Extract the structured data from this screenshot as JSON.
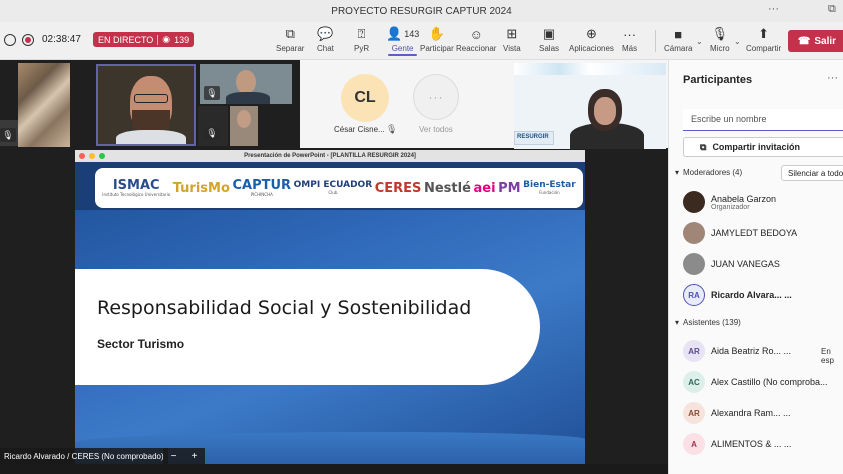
{
  "window": {
    "title": "PROYECTO RESURGIR CAPTUR 2024",
    "more": "···",
    "restore": "⧉"
  },
  "toolbar": {
    "timer": "02:38:47",
    "live_label": "EN DIRECTO",
    "viewers": "139",
    "people_count": "143",
    "buttons": {
      "separar": "Separar",
      "chat": "Chat",
      "pyr": "PyR",
      "gente": "Gente",
      "participar": "Participar",
      "reaccionar": "Reaccionar",
      "vista": "Vista",
      "salas": "Salas",
      "aplicaciones": "Aplicaciones",
      "mas": "Más",
      "camara": "Cámara",
      "micro": "Micro",
      "compartir": "Compartir"
    },
    "leave": "Salir"
  },
  "stage": {
    "cl_initials": "CL",
    "cl_name": "César Cisne...",
    "more_dots": "···",
    "ver_todos": "Ver todos",
    "woman_banner": "RESURGIR",
    "name_tag": "Ricardo Alvarado / CERES (No comprobado)",
    "zoom_minus": "−",
    "zoom_plus": "+"
  },
  "presentation": {
    "window_title": "Presentación de PowerPoint - [PLANTILLA RESURGIR 2024]",
    "logos": [
      {
        "text": "ISMAC",
        "sub": "Instituto Tecnológico Universitario",
        "color": "#2b4c8c"
      },
      {
        "text": "TurisMo",
        "sub": "",
        "color": "#d2a429"
      },
      {
        "text": "CAPTUR",
        "sub": "PICHINCHA",
        "color": "#1a5fa8"
      },
      {
        "text": "OMPI ECUADOR",
        "sub": "Club",
        "color": "#1f3f7a"
      },
      {
        "text": "CERES",
        "sub": "",
        "color": "#c0392b"
      },
      {
        "text": "Nestlé",
        "sub": "",
        "color": "#555555"
      },
      {
        "text": "aei",
        "sub": "",
        "color": "#e4007f"
      },
      {
        "text": "PM",
        "sub": "",
        "color": "#7b3fa0"
      },
      {
        "text": "Bien-Estar",
        "sub": "Fundación",
        "color": "#1f5ea8"
      }
    ],
    "title": "Responsabilidad Social y Sostenibilidad",
    "subtitle": "Sector Turismo"
  },
  "panel": {
    "title": "Participantes",
    "more": "···",
    "search_placeholder": "Escribe un nombre",
    "invite": "Compartir invitación",
    "moderators_header": "Moderadores (4)",
    "mute_all": "Silenciar a todos",
    "moderators": [
      {
        "name": "Anabela Garzon",
        "role": "Organizador",
        "initials": ""
      },
      {
        "name": "JAMYLEDT BEDOYA",
        "role": "",
        "initials": ""
      },
      {
        "name": "JUAN VANEGAS",
        "role": "",
        "initials": ""
      },
      {
        "name": "Ricardo Alvara... ...",
        "role": "",
        "initials": "RA"
      }
    ],
    "attendees_header": "Asistentes (139)",
    "attendees": [
      {
        "name": "Aida Beatriz Ro... ...",
        "initials": "AR",
        "extra": "En esp"
      },
      {
        "name": "Alex Castillo (No comproba...",
        "initials": "AC",
        "extra": ""
      },
      {
        "name": "Alexandra Ram... ...",
        "initials": "AR",
        "extra": ""
      },
      {
        "name": "ALIMENTOS & ... ...",
        "initials": "A",
        "extra": ""
      }
    ]
  }
}
